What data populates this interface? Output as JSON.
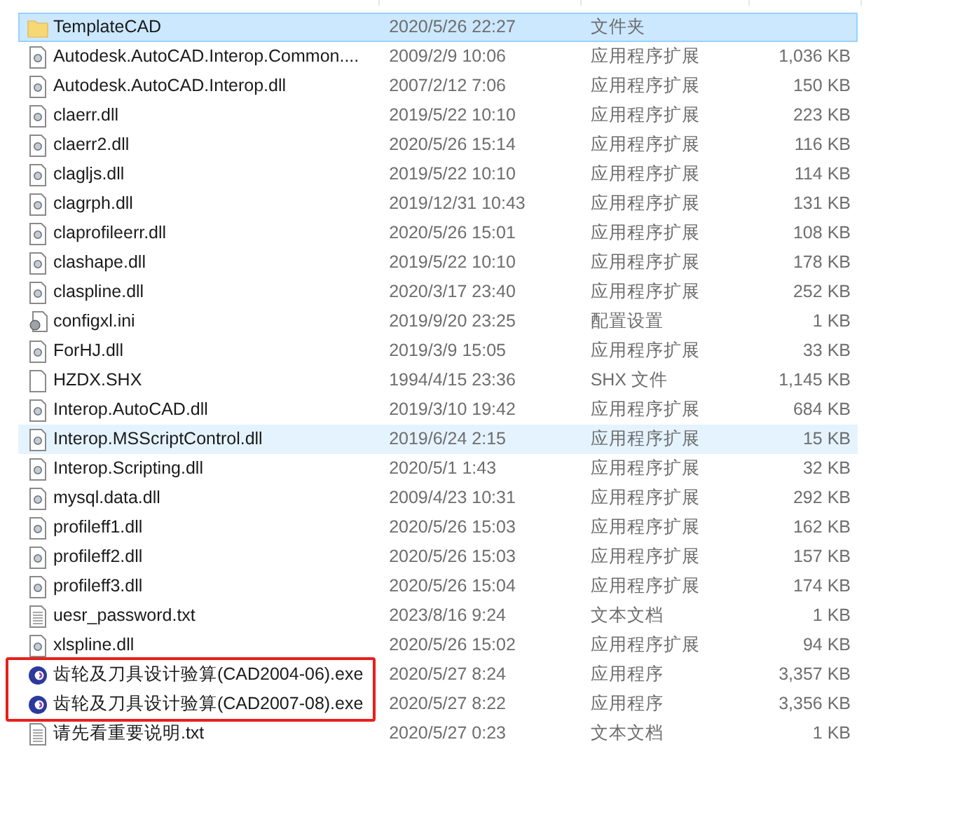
{
  "files": [
    {
      "kind": "folder",
      "name": "TemplateCAD",
      "date": "2020/5/26 22:27",
      "type": "文件夹",
      "selected": true,
      "hovered": false,
      "annotated": false
    },
    {
      "kind": "dll",
      "name": "Autodesk.AutoCAD.Interop.Common....",
      "date": "2009/2/9 10:06",
      "type": "应用程序扩展",
      "size": "1,036 KB",
      "selected": false,
      "hovered": false,
      "annotated": false
    },
    {
      "kind": "dll",
      "name": "Autodesk.AutoCAD.Interop.dll",
      "date": "2007/2/12 7:06",
      "type": "应用程序扩展",
      "size": "150 KB",
      "selected": false,
      "hovered": false,
      "annotated": false
    },
    {
      "kind": "dll",
      "name": "claerr.dll",
      "date": "2019/5/22 10:10",
      "type": "应用程序扩展",
      "size": "223 KB",
      "selected": false,
      "hovered": false,
      "annotated": false
    },
    {
      "kind": "dll",
      "name": "claerr2.dll",
      "date": "2020/5/26 15:14",
      "type": "应用程序扩展",
      "size": "116 KB",
      "selected": false,
      "hovered": false,
      "annotated": false
    },
    {
      "kind": "dll",
      "name": "clagljs.dll",
      "date": "2019/5/22 10:10",
      "type": "应用程序扩展",
      "size": "114 KB",
      "selected": false,
      "hovered": false,
      "annotated": false
    },
    {
      "kind": "dll",
      "name": "clagrph.dll",
      "date": "2019/12/31 10:43",
      "type": "应用程序扩展",
      "size": "131 KB",
      "selected": false,
      "hovered": false,
      "annotated": false
    },
    {
      "kind": "dll",
      "name": "claprofileerr.dll",
      "date": "2020/5/26 15:01",
      "type": "应用程序扩展",
      "size": "108 KB",
      "selected": false,
      "hovered": false,
      "annotated": false
    },
    {
      "kind": "dll",
      "name": "clashape.dll",
      "date": "2019/5/22 10:10",
      "type": "应用程序扩展",
      "size": "178 KB",
      "selected": false,
      "hovered": false,
      "annotated": false
    },
    {
      "kind": "dll",
      "name": "claspline.dll",
      "date": "2020/3/17 23:40",
      "type": "应用程序扩展",
      "size": "252 KB",
      "selected": false,
      "hovered": false,
      "annotated": false
    },
    {
      "kind": "ini",
      "name": "configxl.ini",
      "date": "2019/9/20 23:25",
      "type": "配置设置",
      "size": "1 KB",
      "selected": false,
      "hovered": false,
      "annotated": false
    },
    {
      "kind": "dll",
      "name": "ForHJ.dll",
      "date": "2019/3/9 15:05",
      "type": "应用程序扩展",
      "size": "33 KB",
      "selected": false,
      "hovered": false,
      "annotated": false
    },
    {
      "kind": "file",
      "name": "HZDX.SHX",
      "date": "1994/4/15 23:36",
      "type": "SHX 文件",
      "size": "1,145 KB",
      "selected": false,
      "hovered": false,
      "annotated": false
    },
    {
      "kind": "dll",
      "name": "Interop.AutoCAD.dll",
      "date": "2019/3/10 19:42",
      "type": "应用程序扩展",
      "size": "684 KB",
      "selected": false,
      "hovered": false,
      "annotated": false
    },
    {
      "kind": "dll",
      "name": "Interop.MSScriptControl.dll",
      "date": "2019/6/24 2:15",
      "type": "应用程序扩展",
      "size": "15 KB",
      "selected": false,
      "hovered": true,
      "annotated": false
    },
    {
      "kind": "dll",
      "name": "Interop.Scripting.dll",
      "date": "2020/5/1 1:43",
      "type": "应用程序扩展",
      "size": "32 KB",
      "selected": false,
      "hovered": false,
      "annotated": false
    },
    {
      "kind": "dll",
      "name": "mysql.data.dll",
      "date": "2009/4/23 10:31",
      "type": "应用程序扩展",
      "size": "292 KB",
      "selected": false,
      "hovered": false,
      "annotated": false
    },
    {
      "kind": "dll",
      "name": "profileff1.dll",
      "date": "2020/5/26 15:03",
      "type": "应用程序扩展",
      "size": "162 KB",
      "selected": false,
      "hovered": false,
      "annotated": false
    },
    {
      "kind": "dll",
      "name": "profileff2.dll",
      "date": "2020/5/26 15:03",
      "type": "应用程序扩展",
      "size": "157 KB",
      "selected": false,
      "hovered": false,
      "annotated": false
    },
    {
      "kind": "dll",
      "name": "profileff3.dll",
      "date": "2020/5/26 15:04",
      "type": "应用程序扩展",
      "size": "174 KB",
      "selected": false,
      "hovered": false,
      "annotated": false
    },
    {
      "kind": "txt",
      "name": "uesr_password.txt",
      "date": "2023/8/16 9:24",
      "type": "文本文档",
      "size": "1 KB",
      "selected": false,
      "hovered": false,
      "annotated": false
    },
    {
      "kind": "dll",
      "name": "xlspline.dll",
      "date": "2020/5/26 15:02",
      "type": "应用程序扩展",
      "size": "94 KB",
      "selected": false,
      "hovered": false,
      "annotated": false
    },
    {
      "kind": "exe",
      "name": "齿轮及刀具设计验算(CAD2004-06).exe",
      "date": "2020/5/27 8:24",
      "type": "应用程序",
      "size": "3,357 KB",
      "selected": false,
      "hovered": false,
      "annotated": true
    },
    {
      "kind": "exe",
      "name": "齿轮及刀具设计验算(CAD2007-08).exe",
      "date": "2020/5/27 8:22",
      "type": "应用程序",
      "size": "3,356 KB",
      "selected": false,
      "hovered": false,
      "annotated": true
    },
    {
      "kind": "txt",
      "name": "请先看重要说明.txt",
      "date": "2020/5/27 0:23",
      "type": "文本文档",
      "size": "1 KB",
      "selected": false,
      "hovered": false,
      "annotated": false
    }
  ]
}
